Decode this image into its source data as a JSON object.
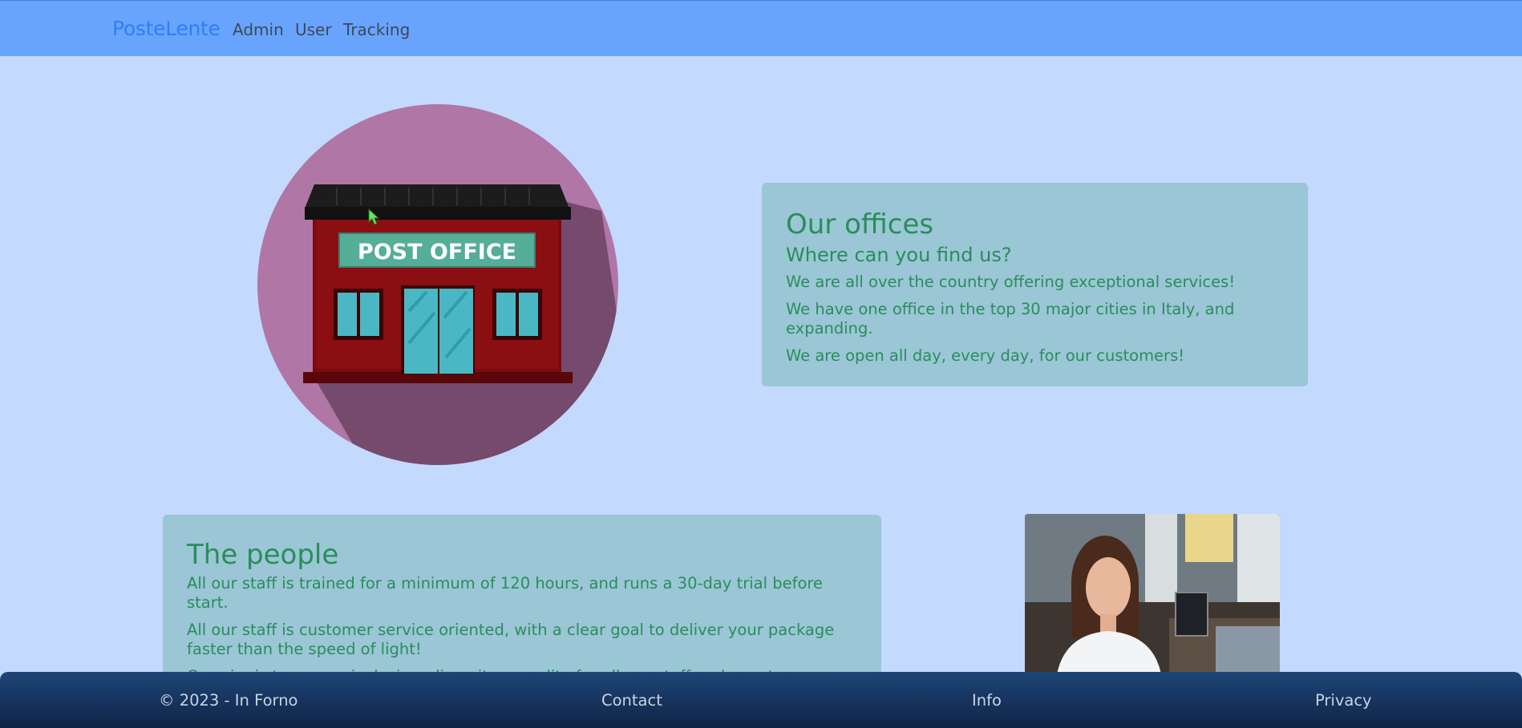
{
  "navbar": {
    "brand": "PosteLente",
    "links": [
      "Admin",
      "User",
      "Tracking"
    ]
  },
  "hero": {
    "illustration_icon": "post-office-building-icon",
    "sign_text": "POST OFFICE"
  },
  "offices": {
    "title": "Our offices",
    "subtitle": "Where can you find us?",
    "lines": [
      "We are all over the country offering exceptional services!",
      "We have one office in the top 30 major cities in Italy, and expanding.",
      "We are open all day, every day, for our customers!"
    ]
  },
  "people": {
    "title": "The people",
    "lines": [
      "All our staff is trained for a minimum of 120 hours, and runs a 30-day trial before start.",
      "All our staff is customer service oriented, with a clear goal to deliver your package faster than the speed of light!",
      "Our aim is to ensure inclusion, diversity, equality for all our staff and, most importantly, our"
    ],
    "photo_icon": "staff-photo"
  },
  "footer": {
    "copyright": "© 2023 - In Forno",
    "links": [
      "Contact",
      "Info",
      "Privacy"
    ]
  },
  "colors": {
    "page_bg": "#c3d9fe",
    "navbar_bg": "#68a4fe",
    "brand": "#2f7ff6",
    "card_bg": "#9ac6d6",
    "card_text": "#2a8d5a",
    "footer_bg": "#15305a"
  }
}
